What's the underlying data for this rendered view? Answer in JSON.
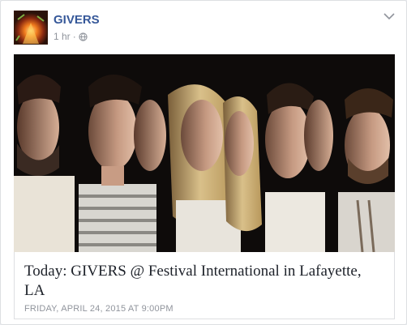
{
  "post": {
    "page_name": "GIVERS",
    "timestamp": "1 hr",
    "separator": "·",
    "privacy_icon": "public-globe-icon"
  },
  "event": {
    "title": "Today: GIVERS @ Festival International in Lafayette, LA",
    "date": "FRIDAY, APRIL 24, 2015 AT 9:00PM"
  },
  "colors": {
    "link": "#365899",
    "meta": "#90949c",
    "border": "#dddfe2"
  }
}
